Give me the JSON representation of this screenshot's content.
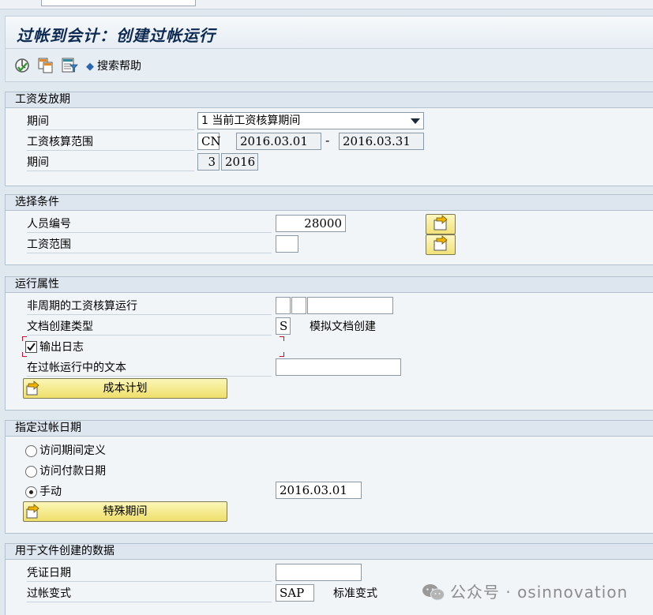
{
  "window": {
    "title": "过帐到会计：创建过帐运行"
  },
  "toolbar": {
    "execute_icon": "execute-icon",
    "copy_icon": "copy-icon",
    "variant_icon": "variant-icon",
    "search_help_label": "搜索帮助"
  },
  "payroll_period": {
    "header": "工资发放期",
    "period_label": "期间",
    "period_value": "1 当前工资核算期间",
    "area_label": "工资核算范围",
    "area_value": "CN",
    "date_from": "2016.03.01",
    "date_sep": "-",
    "date_to": "2016.03.31",
    "period2_label": "期间",
    "period_num": "3",
    "period_year": "2016"
  },
  "selection": {
    "header": "选择条件",
    "personnel_label": "人员编号",
    "personnel_value": "28000",
    "payroll_area_label": "工资范围",
    "payroll_area_value": ""
  },
  "run_attributes": {
    "header": "运行属性",
    "offcycle_label": "非周期的工资核算运行",
    "doc_type_label": "文档创建类型",
    "doc_type_value": "S",
    "doc_type_desc": "模拟文档创建",
    "log_label": "输出日志",
    "log_checked": true,
    "run_text_label": "在过帐运行中的文本",
    "run_text_value": "",
    "cost_plan_button": "成本计划"
  },
  "posting_date": {
    "header": "指定过帐日期",
    "opt1_label": "访问期间定义",
    "opt2_label": "访问付款日期",
    "opt3_label": "手动",
    "selected": "manual",
    "manual_date": "2016.03.01",
    "special_period_button": "特殊期间"
  },
  "doc_data": {
    "header": "用于文件创建的数据",
    "doc_date_label": "凭证日期",
    "doc_date_value": "",
    "posting_variant_label": "过帐变式",
    "posting_variant_value": "SAP",
    "posting_variant_desc": "标准变式"
  },
  "watermark": {
    "text": "公众号 · osinnovation"
  },
  "colors": {
    "button_yellow": "#f2e27a",
    "title_blue": "#0d2a52",
    "group_header": "#dde5ee"
  }
}
